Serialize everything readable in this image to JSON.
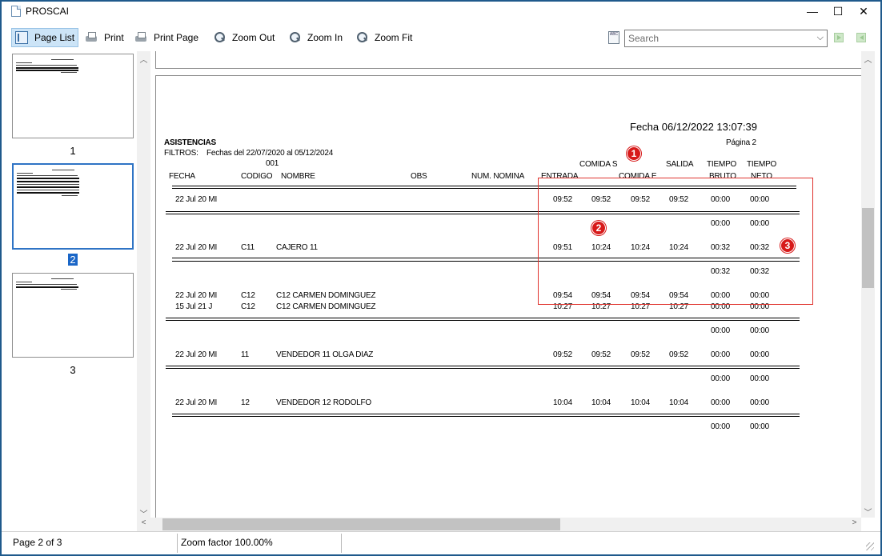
{
  "window": {
    "title": "PROSCAI",
    "minimize": "—",
    "maximize": "☐",
    "close": "✕"
  },
  "toolbar": {
    "page_list": "Page List",
    "print": "Print",
    "print_page": "Print Page",
    "zoom_out": "Zoom Out",
    "zoom_in": "Zoom In",
    "zoom_fit": "Zoom Fit",
    "search_placeholder": "Search",
    "spell_icon": "ABC"
  },
  "thumbnails": {
    "pages": [
      "1",
      "2",
      "3"
    ],
    "selected": 2
  },
  "report": {
    "fecha_header": "Fecha 06/12/2022 13:07:39",
    "pagina": "Página 2",
    "title": "ASISTENCIAS",
    "filtros_label": "FILTROS:",
    "filtros_value": "Fechas del 22/07/2020 al 05/12/2024",
    "group_code": "001",
    "columns": {
      "fecha": "FECHA",
      "codigo": "CODIGO",
      "nombre": "NOMBRE",
      "obs": "OBS",
      "num_nomina": "NUM. NOMINA",
      "entrada": "ENTRADA",
      "comida_s": "COMIDA S",
      "comida_e": "COMIDA E",
      "salida": "SALIDA",
      "tiempo_bruto_1": "TIEMPO",
      "tiempo_bruto_2": "BRUTO",
      "tiempo_neto_1": "TIEMPO",
      "tiempo_neto_2": "NETO"
    },
    "rows": [
      {
        "fecha": "22 Jul 20 MI",
        "codigo": "",
        "nombre": "",
        "entrada": "09:52",
        "comida_s": "09:52",
        "comida_e": "09:52",
        "salida": "09:52",
        "bruto": "00:00",
        "neto": "00:00"
      },
      {
        "fecha": "22 Jul 20 MI",
        "codigo": "C11",
        "nombre": "CAJERO 11",
        "entrada": "09:51",
        "comida_s": "10:24",
        "comida_e": "10:24",
        "salida": "10:24",
        "bruto": "00:32",
        "neto": "00:32"
      },
      {
        "fecha": "22 Jul 20 MI",
        "codigo": "C12",
        "nombre": "C12 CARMEN DOMINGUEZ",
        "entrada": "09:54",
        "comida_s": "09:54",
        "comida_e": "09:54",
        "salida": "09:54",
        "bruto": "00:00",
        "neto": "00:00"
      },
      {
        "fecha": "15 Jul 21 J",
        "codigo": "C12",
        "nombre": "C12 CARMEN DOMINGUEZ",
        "entrada": "10:27",
        "comida_s": "10:27",
        "comida_e": "10:27",
        "salida": "10:27",
        "bruto": "00:00",
        "neto": "00:00"
      },
      {
        "fecha": "22 Jul 20 MI",
        "codigo": "11",
        "nombre": "VENDEDOR 11 OLGA DIAZ",
        "entrada": "09:52",
        "comida_s": "09:52",
        "comida_e": "09:52",
        "salida": "09:52",
        "bruto": "00:00",
        "neto": "00:00"
      },
      {
        "fecha": "22 Jul 20 MI",
        "codigo": "12",
        "nombre": "VENDEDOR 12 RODOLFO",
        "entrada": "10:04",
        "comida_s": "10:04",
        "comida_e": "10:04",
        "salida": "10:04",
        "bruto": "00:00",
        "neto": "00:00"
      }
    ],
    "subtotals": [
      {
        "bruto": "00:00",
        "neto": "00:00"
      },
      {
        "bruto": "00:32",
        "neto": "00:32"
      },
      {
        "bruto": "00:00",
        "neto": "00:00"
      },
      {
        "bruto": "00:00",
        "neto": "00:00"
      },
      {
        "bruto": "00:00",
        "neto": "00:00"
      }
    ]
  },
  "annotations": {
    "badge_1": "1",
    "badge_2": "2",
    "badge_3": "3",
    "highlight_color": "#e0332e",
    "badge_color": "#d71a1a"
  },
  "status": {
    "page_info": "Page 2 of 3",
    "zoom": "Zoom factor 100.00%"
  },
  "icons": {
    "page_list": "page-list-icon",
    "print": "printer-icon",
    "print_page": "print-page-icon",
    "zoom_out": "zoom-out-icon",
    "zoom_in": "zoom-in-icon",
    "zoom_fit": "zoom-fit-icon"
  },
  "colors": {
    "accent": "#1a66c7",
    "window_border": "#1f5a8c"
  }
}
